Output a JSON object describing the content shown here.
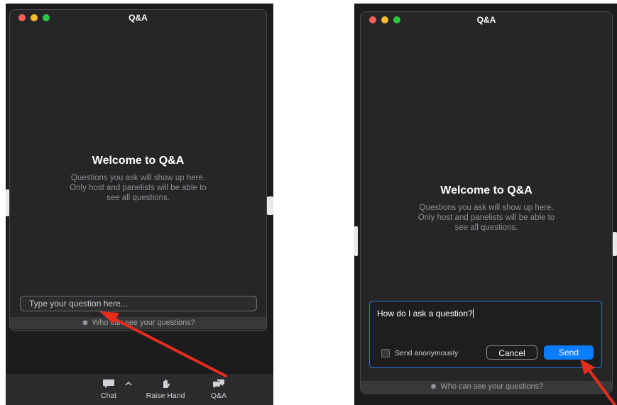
{
  "left_panel": {
    "window_title": "Q&A",
    "welcome_heading": "Welcome to Q&A",
    "welcome_text": "Questions you ask will show up here. Only host and panelists will be able to see all questions.",
    "question_placeholder": "Type your question here...",
    "who_can_see": "Who can see your questions?",
    "toolbar": {
      "chat_label": "Chat",
      "raise_hand_label": "Raise Hand",
      "qa_label": "Q&A"
    }
  },
  "right_panel": {
    "window_title": "Q&A",
    "welcome_heading": "Welcome to Q&A",
    "welcome_text": "Questions you ask will show up here. Only host and panelists will be able to see all questions.",
    "question_value": "How do I ask a question?",
    "send_anonymously_label": "Send anonymously",
    "send_anonymously_checked": false,
    "cancel_label": "Cancel",
    "send_label": "Send",
    "who_can_see": "Who can see your questions?"
  },
  "colors": {
    "window_bg": "#262628",
    "send_button": "#0a7cff",
    "input_focus_border": "#2f6fd6",
    "arrow": "#e52d1e",
    "close_dot": "#ff5f57",
    "minimize_dot": "#febc2e",
    "zoom_dot": "#28c840"
  }
}
